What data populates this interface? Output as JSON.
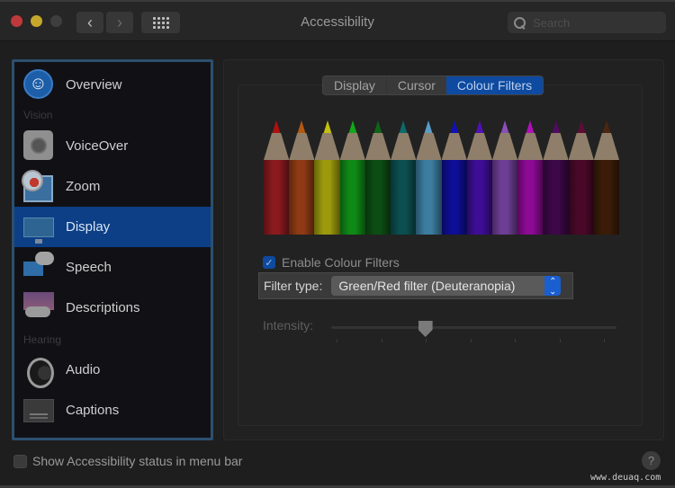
{
  "window": {
    "title": "Accessibility",
    "search_placeholder": "Search",
    "back_glyph": "‹",
    "forward_glyph": "›"
  },
  "sidebar": {
    "sections": {
      "vision": "Vision",
      "hearing": "Hearing"
    },
    "items": [
      {
        "label": "Overview",
        "icon": "accessibility-person-icon"
      },
      {
        "label": "VoiceOver",
        "icon": "voiceover-icon"
      },
      {
        "label": "Zoom",
        "icon": "zoom-magnifier-icon"
      },
      {
        "label": "Display",
        "icon": "display-monitor-icon",
        "selected": true
      },
      {
        "label": "Speech",
        "icon": "speech-bubble-icon"
      },
      {
        "label": "Descriptions",
        "icon": "descriptions-icon"
      },
      {
        "label": "Audio",
        "icon": "speaker-icon"
      },
      {
        "label": "Captions",
        "icon": "captions-icon"
      }
    ]
  },
  "tabs": [
    {
      "label": "Display",
      "selected": false
    },
    {
      "label": "Cursor",
      "selected": false
    },
    {
      "label": "Colour Filters",
      "selected": true
    }
  ],
  "colour_filters": {
    "pencil_colors": [
      "#8a1a1e",
      "#8f3a14",
      "#9c9a0c",
      "#0f8a16",
      "#0c4d14",
      "#0c4f50",
      "#3c7da0",
      "#0e0e96",
      "#3e0d96",
      "#6e3e94",
      "#8d0a94",
      "#3c0848",
      "#4a0828",
      "#3c1c08"
    ],
    "pencil_tip_colors": [
      "#b01010",
      "#b45810",
      "#c2c010",
      "#10a81a",
      "#0e6418",
      "#0e6a6a",
      "#5a9cc4",
      "#1010b8",
      "#5010b8",
      "#8a50b8",
      "#b010b8",
      "#500c60",
      "#600c36",
      "#4c2610"
    ],
    "enable_label": "Enable Colour Filters",
    "enable_checked": true,
    "checkmark_glyph": "✓",
    "filter_type_label": "Filter type:",
    "filter_type_value": "Green/Red filter (Deuteranopia)",
    "intensity_label": "Intensity:",
    "intensity_value": 0.33,
    "intensity_ticks": 7
  },
  "footer": {
    "status_checkbox_label": "Show Accessibility status in menu bar",
    "status_checked": false,
    "help_glyph": "?",
    "watermark": "www.deuaq.com"
  }
}
